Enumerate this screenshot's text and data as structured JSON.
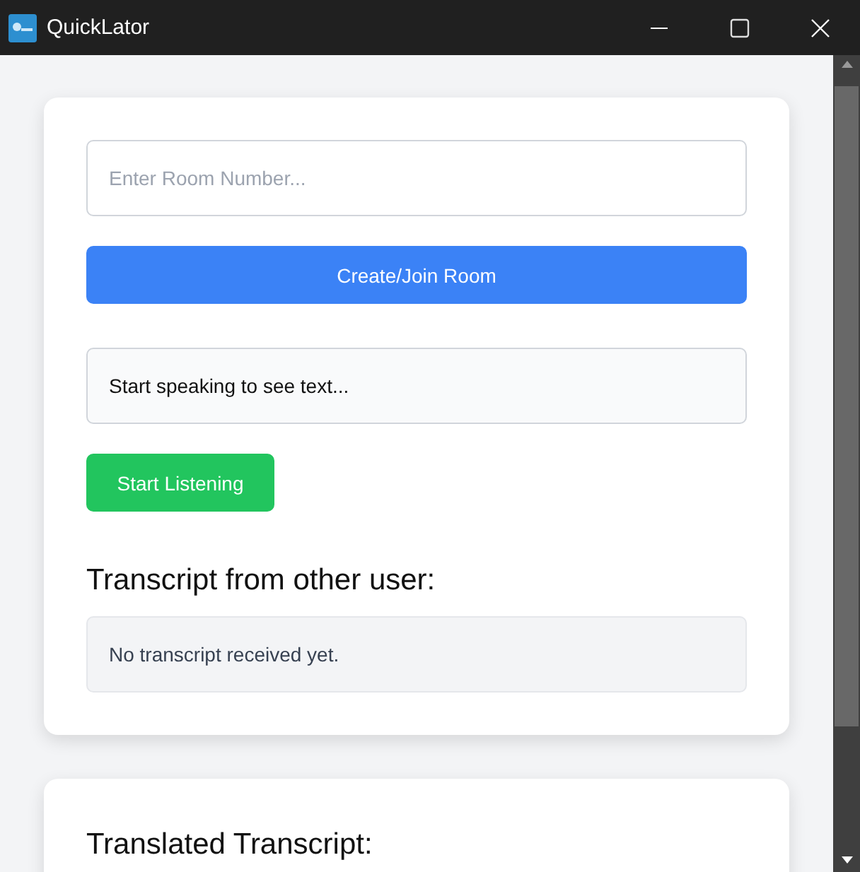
{
  "window": {
    "title": "QuickLator"
  },
  "room": {
    "placeholder": "Enter Room Number..."
  },
  "join_button": "Create/Join Room",
  "speech_output": "Start speaking to see text...",
  "listen_button": "Start Listening",
  "other_transcript": {
    "heading": "Transcript from other user:",
    "text": "No transcript received yet."
  },
  "translated": {
    "heading": "Translated Transcript:"
  }
}
